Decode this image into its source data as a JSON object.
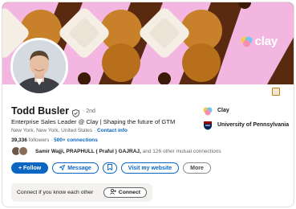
{
  "profile": {
    "name": "Todd Busler",
    "degree": "· 2nd",
    "headline": "Enterprise Sales Leader @ Clay | Shaping the future of GTM",
    "location": "New York, New York, United States ·",
    "contact_info": "Contact info",
    "followers_count": "39,336",
    "followers_label": "followers ·",
    "connections": "500+ connections",
    "mutual_names": "Samir Wajji, PRAPHULL ( Praful ) GAJRAJ,",
    "mutual_rest": "and 126 other mutual connections"
  },
  "banner": {
    "brand_text": "clay"
  },
  "side": {
    "company": "Clay",
    "school": "University of Pennsylvania"
  },
  "actions": {
    "follow": "+ Follow",
    "message": "Message",
    "website": "Visit my website",
    "more": "More"
  },
  "connect_prompt": {
    "question": "Connect if you know each other",
    "button": "Connect"
  },
  "colors": {
    "accent": "#0a66c2",
    "banner_brown": "#5a2a10",
    "banner_pink": "#f2b6e0",
    "banner_orange": "#c8812a"
  },
  "icons": [
    "verified-shield-icon",
    "edit-banner-icon",
    "send-icon",
    "bookmark-icon",
    "connect-person-icon",
    "clay-logo-icon",
    "penn-shield-icon"
  ]
}
